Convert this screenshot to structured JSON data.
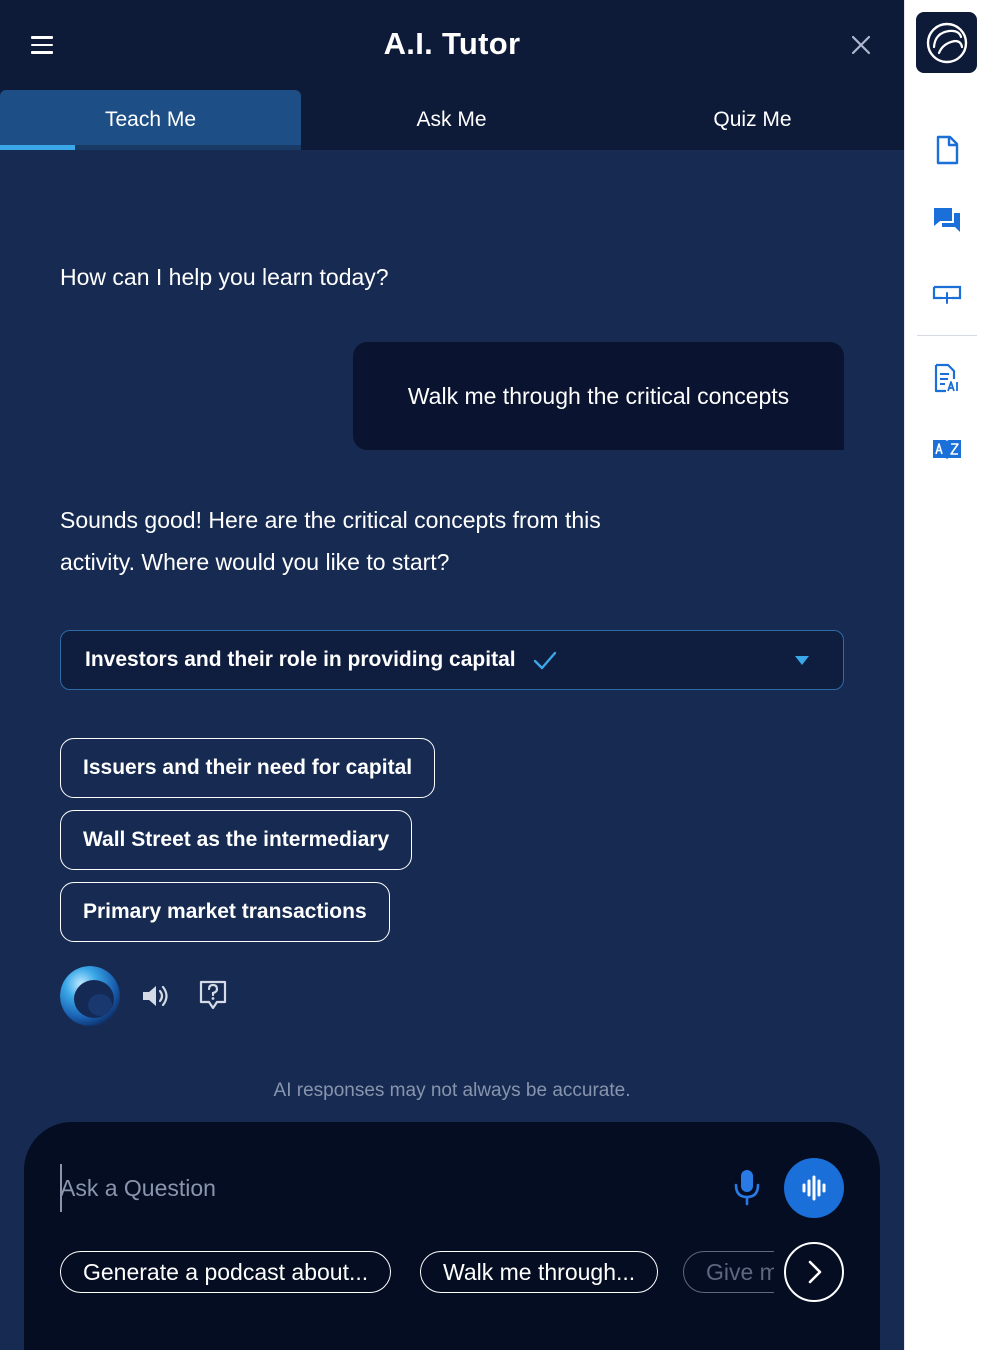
{
  "header": {
    "title": "A.I. Tutor"
  },
  "tabs": [
    {
      "label": "Teach Me",
      "active": true
    },
    {
      "label": "Ask Me",
      "active": false
    },
    {
      "label": "Quiz Me",
      "active": false
    }
  ],
  "chat": {
    "greeting": "How can I help you learn today?",
    "user_message": "Walk me through the critical concepts",
    "reply_line_1": "Sounds good! Here are the critical concepts from this",
    "reply_line_2": "activity. Where would you like to start?",
    "selected_concept": "Investors and their role in providing capital",
    "concept_options": [
      "Issuers and their need for capital",
      "Wall Street as the intermediary",
      "Primary market transactions"
    ]
  },
  "disclaimer": "AI responses may not always be accurate.",
  "composer": {
    "placeholder": "Ask a Question",
    "suggested_prompts": [
      "Generate a podcast about...",
      "Walk me through...",
      "Give m"
    ]
  },
  "colors": {
    "panel_bg": "#172b52",
    "header_bg": "#0d1a38",
    "active_tab": "#1d4f86",
    "accent": "#3aa8e8",
    "primary_button": "#1a6fd8",
    "rail_icon": "#1a6fd8"
  },
  "icons": {
    "rail": [
      "document-icon",
      "chat-icon",
      "slides-icon",
      "ai-notes-icon",
      "dictionary-icon"
    ]
  }
}
